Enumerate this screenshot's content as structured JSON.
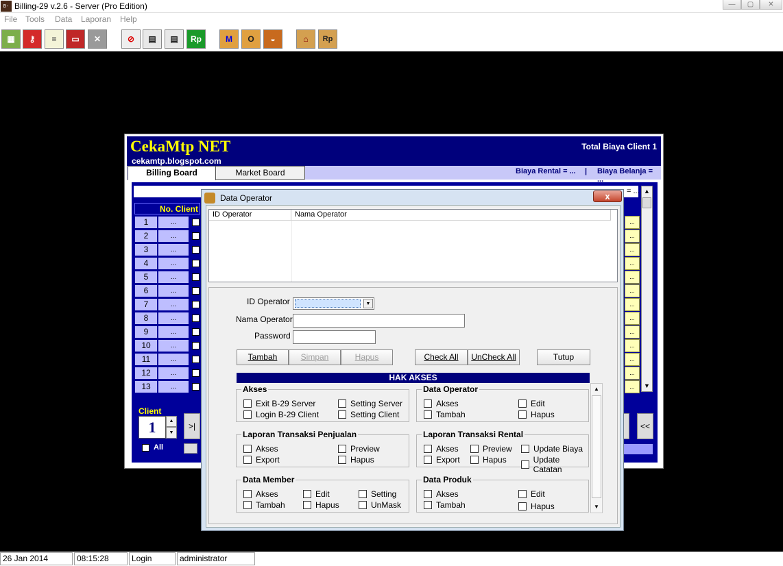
{
  "window": {
    "title": "Billing-29 v.2.6 - Server (Pro Edition)",
    "app_icon_text": "B-29",
    "min_label": "—",
    "max_label": "▢",
    "close_label": "✕"
  },
  "menu": [
    "File",
    "Tools",
    "Data",
    "Laporan",
    "Help"
  ],
  "toolbar": {
    "groups": [
      [
        "building-icon",
        "key-icon",
        "notepad-icon",
        "book-icon",
        "x-icon"
      ],
      [
        "no-entry-icon",
        "calc-cal-icon",
        "calc-sal-icon",
        "rupiah-icon"
      ],
      [
        "member-m-icon",
        "operator-o-icon",
        "burger-icon"
      ],
      [
        "house-icon",
        "house-rp-icon"
      ]
    ],
    "labels": {
      "rupiah": "Rp",
      "member": "M",
      "operator": "O",
      "house_rp": "Rp"
    }
  },
  "board": {
    "brand": "CekaMtp NET",
    "brand_sub": "cekamtp.blogspot.com",
    "total_biaya": "Total Biaya Client 1",
    "tabs": [
      "Billing Board",
      "Market Board"
    ],
    "biaya_rental": "Biaya Rental = ...",
    "separator": "|",
    "biaya_belanja": "Biaya Belanja = ...",
    "column_header": "No. Client",
    "right_header_dots": "= ...",
    "rows": [
      "1",
      "2",
      "3",
      "4",
      "5",
      "6",
      "7",
      "8",
      "9",
      "10",
      "11",
      "12",
      "13"
    ],
    "row_dots": "...",
    "client_label": "Client",
    "client_value": "1",
    "all_label": "All",
    "nav_first": ">|",
    "nav_back": "<<",
    "spin_up": "▲",
    "spin_down": "▼",
    "scroll_up": "▲",
    "scroll_down": "▼"
  },
  "dialog": {
    "title": "Data Operator",
    "close_label": "x",
    "columns": [
      "ID Operator",
      "Nama Operator"
    ],
    "fields": {
      "id_operator": "ID Operator",
      "nama_operator": "Nama Operator",
      "password": "Password"
    },
    "dropdown_arrow": "▼",
    "buttons": {
      "tambah": "Tambah",
      "simpan": "Simpan",
      "hapus": "Hapus",
      "check_all": "Check All",
      "uncheck_all": "UnCheck All",
      "tutup": "Tutup"
    },
    "hak_akses": "HAK AKSES",
    "scroll_up": "▲",
    "scroll_down": "▼",
    "groups": {
      "akses": {
        "title": "Akses",
        "items": [
          "Exit B-29 Server",
          "Setting Server",
          "Login B-29 Client",
          "Setting Client"
        ]
      },
      "data_operator": {
        "title": "Data Operator",
        "items": [
          "Akses",
          "Edit",
          "Tambah",
          "Hapus"
        ]
      },
      "laporan_penjualan": {
        "title": "Laporan Transaksi Penjualan",
        "items": [
          "Akses",
          "Preview",
          "Export",
          "Hapus"
        ]
      },
      "laporan_rental": {
        "title": "Laporan Transaksi Rental",
        "items": [
          "Akses",
          "Preview",
          "Update Biaya",
          "Export",
          "Hapus",
          "Update Catatan"
        ]
      },
      "data_member": {
        "title": "Data Member",
        "items": [
          "Akses",
          "Edit",
          "Setting",
          "Tambah",
          "Hapus",
          "UnMask"
        ]
      },
      "data_produk": {
        "title": "Data Produk",
        "items": [
          "Akses",
          "Edit",
          "Tambah",
          "Hapus"
        ]
      }
    }
  },
  "status": {
    "date": "26 Jan 2014",
    "time": "08:15:28",
    "mode": "Login",
    "user": "administrator"
  },
  "colors": {
    "navy": "#00007c",
    "brand_yellow": "#ffff00",
    "row_lavender": "#bebeff",
    "cell_yellow": "#ffffb8"
  }
}
